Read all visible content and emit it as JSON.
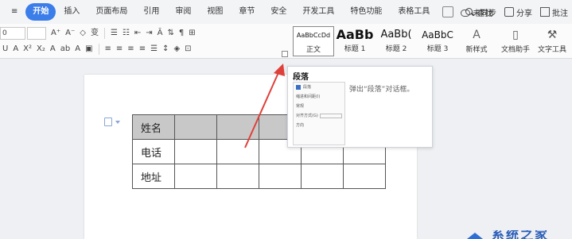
{
  "menu": {
    "tabs": [
      "开始",
      "插入",
      "页面布局",
      "引用",
      "审阅",
      "视图",
      "章节",
      "安全",
      "开发工具",
      "特色功能",
      "表格工具"
    ],
    "active_tab": "开始",
    "search_label": "查找",
    "sync_label": "未同步",
    "share_label": "分享",
    "annotate_label": "批注"
  },
  "ribbon": {
    "font_name": "0",
    "styles": [
      {
        "preview": "AaBbCcDd",
        "name": "正文"
      },
      {
        "preview": "AaBb",
        "name": "标题 1"
      },
      {
        "preview": "AaBb(",
        "name": "标题 2"
      },
      {
        "preview": "AaBbC",
        "name": "标题 3"
      }
    ],
    "new_style_label": "新样式",
    "doc_helper_label": "文档助手",
    "text_tools_label": "文字工具"
  },
  "tooltip": {
    "title": "段落",
    "description": "弹出“段落”对话框。",
    "thumb_labels": [
      "段落",
      "缩进和间距(I)",
      "常规",
      "对齐方式(G)",
      "方向"
    ]
  },
  "table": {
    "rows": [
      [
        "姓名",
        "",
        "",
        "",
        "",
        ""
      ],
      [
        "电话",
        "",
        "",
        "",
        "",
        ""
      ],
      [
        "地址",
        "",
        "",
        "",
        "",
        ""
      ]
    ]
  },
  "watermark": {
    "text": "系统之家"
  },
  "colors": {
    "accent": "#3b7de9",
    "arrow": "#e0403a",
    "header_cell": "#c8c8c8"
  }
}
